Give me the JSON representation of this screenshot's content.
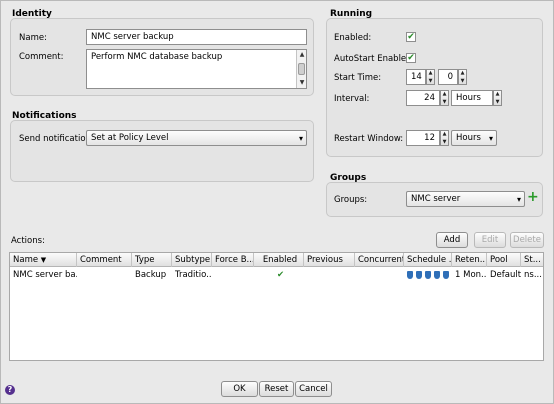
{
  "identity": {
    "title": "Identity",
    "name_label": "Name:",
    "name_value": "NMC server backup",
    "comment_label": "Comment:",
    "comment_value": "Perform NMC database backup"
  },
  "notifications": {
    "title": "Notifications",
    "send_label": "Send notification:",
    "send_value": "Set at Policy Level"
  },
  "running": {
    "title": "Running",
    "enabled_label": "Enabled:",
    "enabled_checked": true,
    "autostart_label": "AutoStart Enabled:",
    "autostart_checked": true,
    "start_time_label": "Start Time:",
    "start_hour": "14",
    "start_minute": "0",
    "interval_label": "Interval:",
    "interval_value": "24",
    "interval_unit": "Hours",
    "restart_label": "Restart Window:",
    "restart_value": "12",
    "restart_unit": "Hours"
  },
  "groups": {
    "title": "Groups",
    "groups_label": "Groups:",
    "groups_value": "NMC server"
  },
  "actions": {
    "label": "Actions:",
    "add_label": "Add",
    "edit_label": "Edit",
    "delete_label": "Delete",
    "columns": [
      "Name",
      "Comment",
      "Type",
      "Subtype",
      "Force B...",
      "Enabled",
      "Previous",
      "Concurrent",
      "Schedule ...",
      "Reten...",
      "Pool",
      "St..."
    ],
    "sort_indicator": "▼",
    "rows": [
      {
        "name": "NMC server ba...",
        "comment": "",
        "type": "Backup",
        "subtype": "Traditio...",
        "force": "",
        "enabled": "✔",
        "previous": "",
        "concurrent": "",
        "retention": "1 Mon...",
        "pool": "Default",
        "status": "ns..."
      }
    ]
  },
  "footer": {
    "ok_label": "OK",
    "reset_label": "Reset",
    "cancel_label": "Cancel",
    "help_glyph": "?"
  },
  "icons": {
    "check_glyph": "✔",
    "caret_glyph": "▾",
    "add_group_glyph": "+"
  }
}
